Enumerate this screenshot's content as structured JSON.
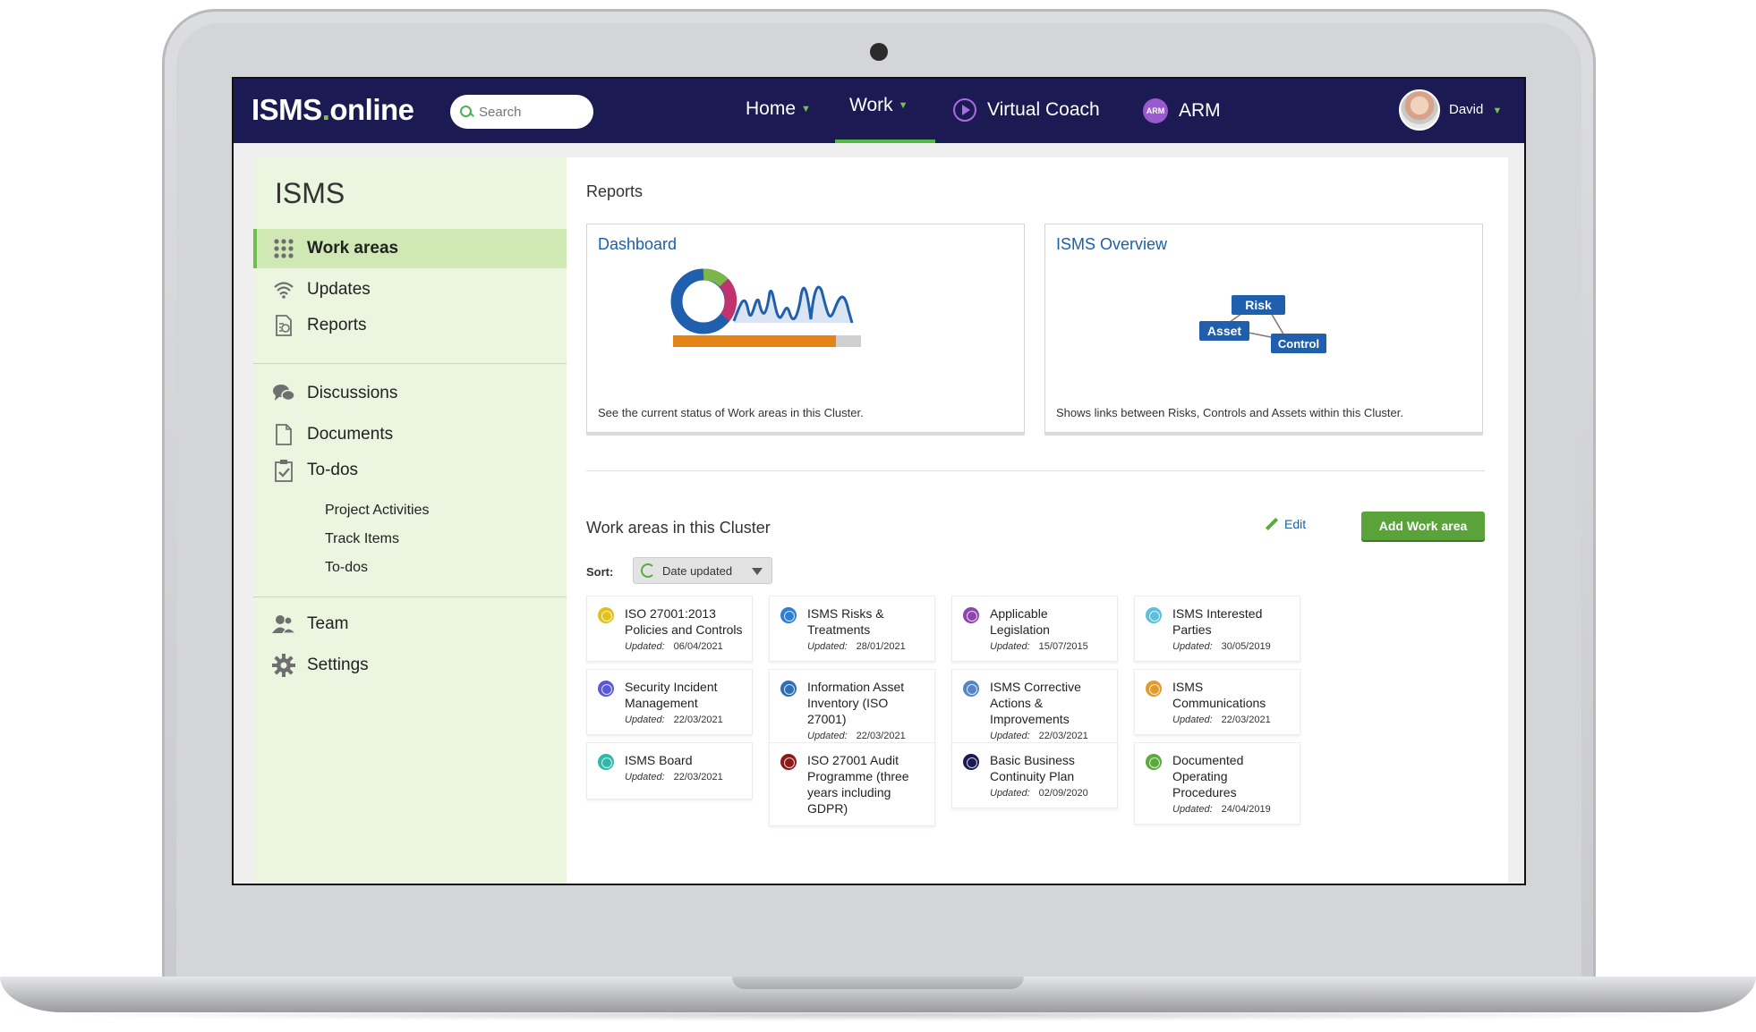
{
  "app": {
    "logo_main": "ISMS",
    "logo_dot": ".",
    "logo_suffix": "online"
  },
  "search": {
    "placeholder": "Search"
  },
  "nav": {
    "items": [
      {
        "label": "Home"
      },
      {
        "label": "Work"
      },
      {
        "label": "Virtual Coach"
      },
      {
        "label": "ARM",
        "badge": "ARM"
      }
    ],
    "user": {
      "name": "David"
    }
  },
  "sidebar": {
    "title": "ISMS",
    "items": [
      {
        "label": "Work areas",
        "icon": "grid-dots-icon"
      },
      {
        "label": "Updates",
        "icon": "wifi-icon"
      },
      {
        "label": "Reports",
        "icon": "report-icon"
      },
      {
        "label": "Discussions",
        "icon": "chat-bubbles-icon"
      },
      {
        "label": "Documents",
        "icon": "document-icon"
      },
      {
        "label": "To-dos",
        "icon": "clipboard-check-icon"
      }
    ],
    "subitems": [
      "Project Activities",
      "Track Items",
      "To-dos"
    ],
    "bottom_items": [
      {
        "label": "Team",
        "icon": "team-icon"
      },
      {
        "label": "Settings",
        "icon": "gear-icon"
      }
    ]
  },
  "reports": {
    "title": "Reports",
    "cards": [
      {
        "title": "Dashboard",
        "desc": "See the current status of Work areas in this Cluster."
      },
      {
        "title": "ISMS Overview",
        "desc": "Shows links between Risks, Controls and Assets within this Cluster.",
        "nodes": [
          "Risk",
          "Asset",
          "Control"
        ]
      }
    ]
  },
  "work_areas": {
    "title": "Work areas in this Cluster",
    "edit_label": "Edit",
    "add_label": "Add Work area",
    "sort_label": "Sort:",
    "sort_value": "Date updated",
    "updated_label": "Updated:",
    "cards": [
      {
        "name": "ISO 27001:2013 Policies and Controls",
        "updated": "06/04/2021",
        "color": "#e2c21a"
      },
      {
        "name": "ISMS Risks & Treatments",
        "updated": "28/01/2021",
        "color": "#2e7fd0"
      },
      {
        "name": "Applicable Legislation",
        "updated": "15/07/2015",
        "color": "#8e44ad"
      },
      {
        "name": "ISMS Interested Parties",
        "updated": "30/05/2019",
        "color": "#5bc0de"
      },
      {
        "name": "Security Incident Management",
        "updated": "22/03/2021",
        "color": "#5a5ad6"
      },
      {
        "name": "Information Asset Inventory (ISO 27001)",
        "updated": "22/03/2021",
        "color": "#2c6fb5"
      },
      {
        "name": "ISMS Corrective Actions & Improvements",
        "updated": "22/03/2021",
        "color": "#5486c6"
      },
      {
        "name": "ISMS Communications",
        "updated": "22/03/2021",
        "color": "#e39a2c"
      },
      {
        "name": "ISMS Board",
        "updated": "22/03/2021",
        "color": "#2fb9a8"
      },
      {
        "name": "ISO 27001 Audit Programme (three years including GDPR)",
        "updated": "",
        "color": "#8b1a1a"
      },
      {
        "name": "Basic Business Continuity Plan",
        "updated": "02/09/2020",
        "color": "#1c1a52"
      },
      {
        "name": "Documented Operating Procedures",
        "updated": "24/04/2019",
        "color": "#5aaa3c"
      }
    ]
  },
  "colors": {
    "nav_bg": "#1c1a52",
    "accent_green": "#5aa33a",
    "link_blue": "#1c5fa8",
    "sidebar_bg": "#ebf5df"
  }
}
